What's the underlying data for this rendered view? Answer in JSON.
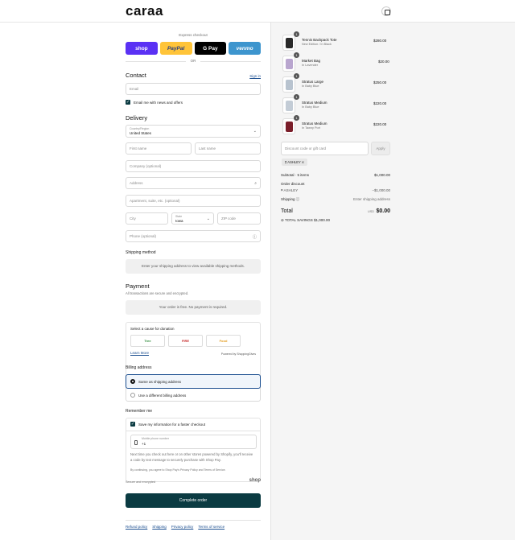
{
  "header": {
    "logo": "caraa"
  },
  "express": {
    "title": "Express checkout",
    "buttons": [
      "shop",
      "PayPal",
      "G Pay",
      "venmo"
    ],
    "or": "OR"
  },
  "contact": {
    "heading": "Contact",
    "sign_in": "Sign in",
    "email_placeholder": "Email",
    "newsletter_label": "Email me with news and offers"
  },
  "delivery": {
    "heading": "Delivery",
    "country_label": "Country/Region",
    "country_value": "United States",
    "first_name": "First name",
    "last_name": "Last name",
    "company": "Company (optional)",
    "address": "Address",
    "apartment": "Apartment, suite, etc. (optional)",
    "city": "City",
    "state_label": "State",
    "state_value": "Iowa",
    "zip": "ZIP code",
    "phone": "Phone (optional)"
  },
  "shipping": {
    "heading": "Shipping method",
    "info": "Enter your shipping address to view available shipping methods."
  },
  "payment": {
    "heading": "Payment",
    "sub": "All transactions are secure and encrypted.",
    "info": "Your order is free. No payment is required."
  },
  "donation": {
    "title": "Select a cause for donation",
    "causes": [
      "Tree",
      "FIRE",
      "Food"
    ],
    "learn_more": "Learn More",
    "powered": "Powered by ShoppingGives"
  },
  "billing": {
    "heading": "Billing address",
    "option_same": "Same as shipping address",
    "option_diff": "Use a different billing address"
  },
  "remember": {
    "heading": "Remember me",
    "save_label": "Save my information for a faster checkout",
    "phone_label": "Mobile phone number",
    "phone_value": "+1",
    "fine1": "Next time you check out here or on other stores powered by Shopify, you'll receive a code by text message to securely purchase with Shop Pay.",
    "fine2": "By continuing, you agree to Shop Pay's Privacy Policy and Terms of Service.",
    "secure": "Secure and encrypted",
    "shop_logo": "shop"
  },
  "complete_button": "Complete order",
  "footer": [
    "Refund policy",
    "Shipping",
    "Privacy policy",
    "Terms of service"
  ],
  "cart": {
    "items": [
      {
        "qty": "1",
        "name": "Tennis Backpack Tote",
        "variant": "New Edition / In Black",
        "price": "$280.00",
        "color": "#2a2a2a"
      },
      {
        "qty": "1",
        "name": "Market Bag",
        "variant": "In Lavender",
        "price": "$20.00",
        "color": "#b9a6cf"
      },
      {
        "qty": "1",
        "name": "Stratus Large",
        "variant": "In Baby Blue",
        "price": "$250.00",
        "color": "#b8c3cf"
      },
      {
        "qty": "1",
        "name": "Stratus Medium",
        "variant": "In Baby Blue",
        "price": "$220.00",
        "color": "#c3ccd6"
      },
      {
        "qty": "1",
        "name": "Stratus Medium",
        "variant": "In Tawny Port",
        "price": "$220.00",
        "color": "#7a1e2a"
      }
    ],
    "discount_placeholder": "Discount code or gift card",
    "apply": "Apply",
    "tag": "ASHLEY",
    "subtotal_label": "Subtotal · 5 items",
    "subtotal_value": "$1,000.00",
    "order_discount_label": "Order discount",
    "discount_code": "ASHLEY",
    "discount_value": "−$1,000.00",
    "shipping_label": "Shipping",
    "shipping_value": "Enter shipping address",
    "total_label": "Total",
    "currency": "USD",
    "total_value": "$0.00",
    "savings": "TOTAL SAVINGS  $1,000.00"
  },
  "colors": {
    "accent": "#0b3b42",
    "link": "#1a4d8f",
    "shop_purple": "#5a31f4"
  }
}
